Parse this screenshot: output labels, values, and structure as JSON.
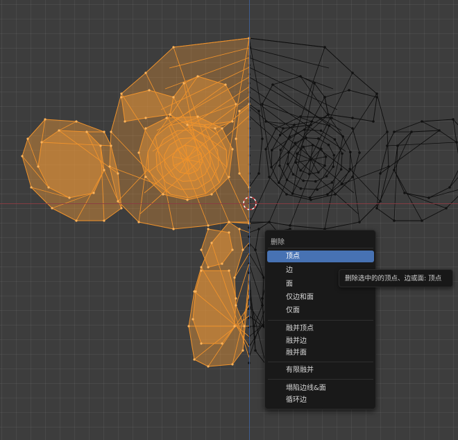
{
  "viewport": {
    "colors": {
      "background": "#3d3d3d",
      "selected_wire": "#f0932c",
      "selected_fill": "#e8963a",
      "unselected_wire": "#0c0c0c",
      "x_axis": "#8c3b43",
      "y_axis": "#3e5f98",
      "menu_highlight": "#4772b3"
    }
  },
  "context_menu": {
    "title": "删除",
    "items": [
      {
        "label": "顶点",
        "active": true
      },
      {
        "label": "边",
        "active": false
      },
      {
        "label": "面",
        "active": false
      },
      {
        "label": "仅边和面",
        "active": false
      },
      {
        "label": "仅面",
        "active": false
      },
      {
        "label": "融并顶点",
        "active": false
      },
      {
        "label": "融并边",
        "active": false
      },
      {
        "label": "融并面",
        "active": false
      },
      {
        "label": "有限融并",
        "active": false
      },
      {
        "label": "塌陷边线&面",
        "active": false
      },
      {
        "label": "循环边",
        "active": false
      }
    ]
  },
  "tooltip": {
    "text": "删除选中的的顶点、边或面: 顶点"
  }
}
